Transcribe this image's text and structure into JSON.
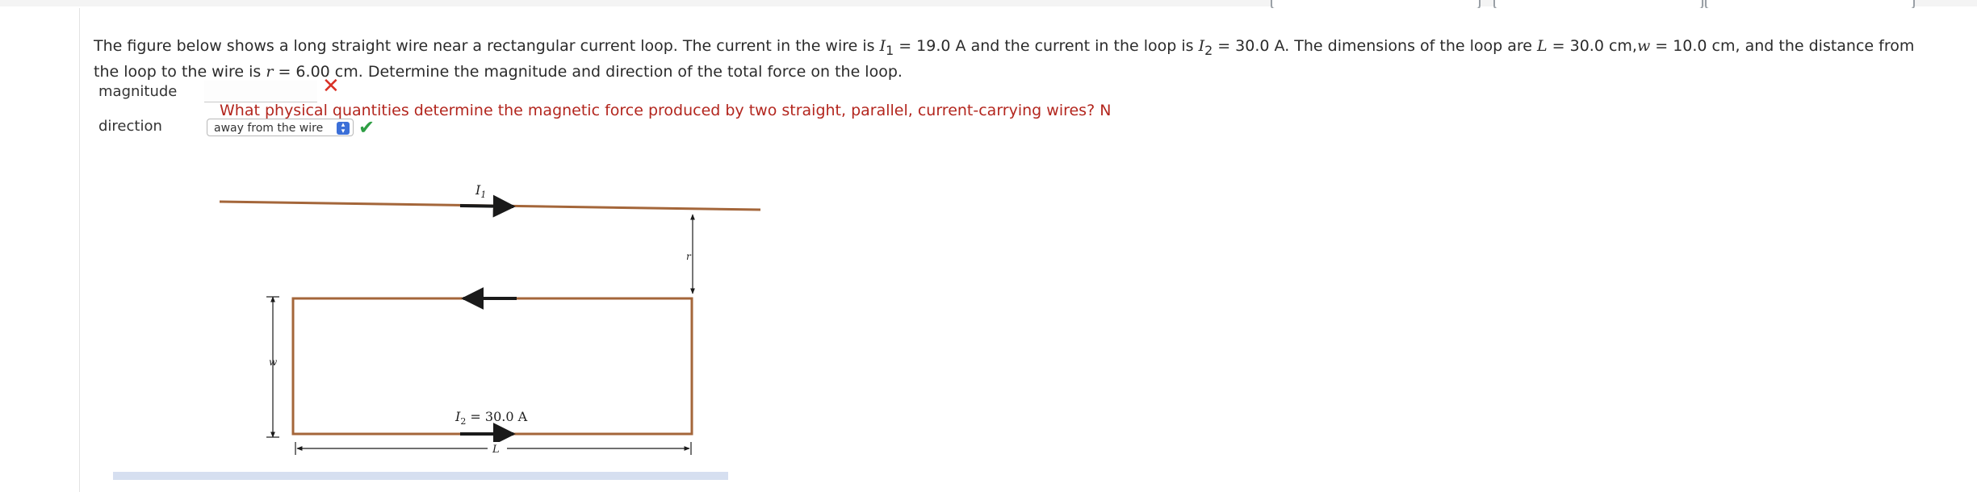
{
  "problem": {
    "text_1": "The figure below shows a long straight wire near a rectangular current loop. The current in the wire is ",
    "i1_symbol": "I",
    "i1_sub": "1",
    "text_2": " = 19.0 A and the current in the loop is ",
    "i2_symbol": "I",
    "i2_sub": "2",
    "text_3": " = 30.0 A. The dimensions of the loop are ",
    "l_symbol": "L",
    "text_4": " = 30.0 cm,",
    "w_symbol": "w",
    "text_5": " = 10.0 cm, and the distance from the loop to the wire is ",
    "r_symbol": "r",
    "text_6": " = 6.00 cm. Determine the magnitude and direction of the total force on the loop."
  },
  "answers": {
    "magnitude_label": "magnitude",
    "magnitude_value": "",
    "magnitude_status": "incorrect",
    "hint": "What physical quantities determine the magnetic force produced by two straight, parallel, current-carrying wires? N",
    "direction_label": "direction",
    "direction_value": "away from the wire",
    "direction_status": "correct"
  },
  "figure": {
    "wire_current_label": "I1",
    "loop_current_label": "I2 = 30.0 A",
    "r_label": "r",
    "w_label": "w",
    "l_label": "L"
  },
  "icons": {
    "wrong": "cross-icon",
    "right": "check-icon",
    "select": "chevron-updown-icon"
  },
  "colors": {
    "wire": "#a4663a",
    "arrow": "#1a1a1a",
    "correct": "#2e9e44",
    "incorrect": "#d93025",
    "value_blue": "#1f5fbf"
  }
}
